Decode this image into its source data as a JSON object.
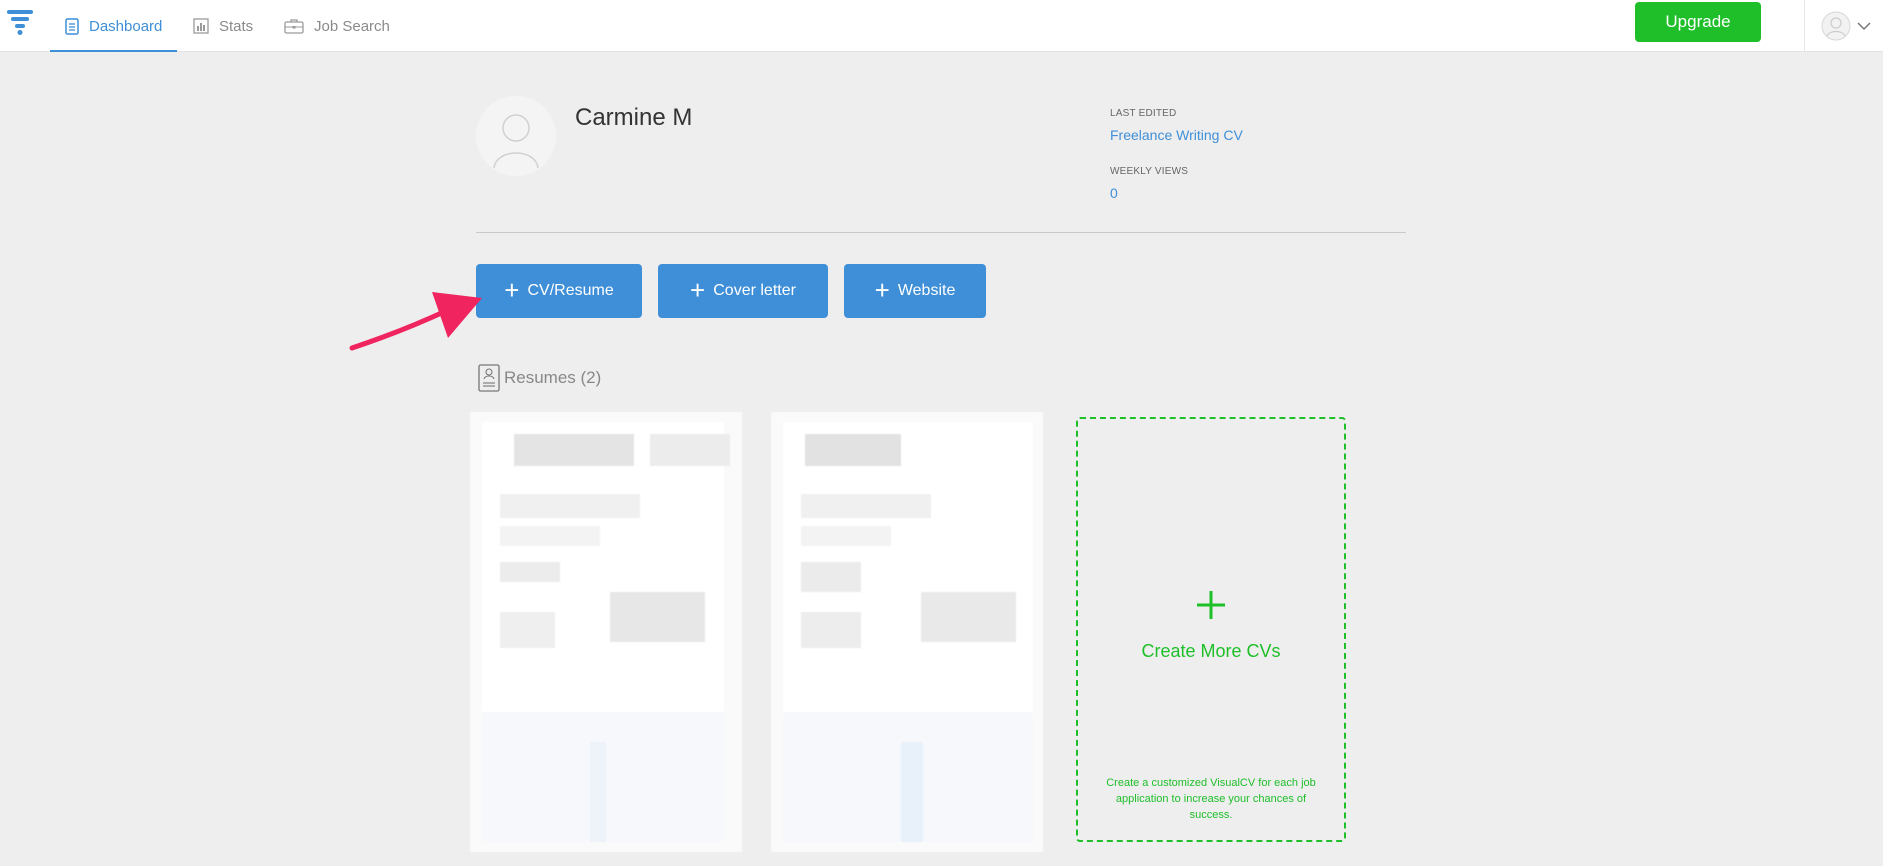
{
  "nav": {
    "tabs": [
      {
        "label": "Dashboard",
        "icon": "document-icon",
        "active": true
      },
      {
        "label": "Stats",
        "icon": "bar-chart-icon",
        "active": false
      },
      {
        "label": "Job Search",
        "icon": "briefcase-icon",
        "active": false
      }
    ],
    "upgrade_label": "Upgrade"
  },
  "profile": {
    "name": "Carmine M",
    "last_edited_label": "LAST EDITED",
    "last_edited_value": "Freelance Writing CV",
    "weekly_views_label": "WEEKLY VIEWS",
    "weekly_views_value": "0"
  },
  "actions": [
    {
      "label": "CV/Resume"
    },
    {
      "label": "Cover letter"
    },
    {
      "label": "Website"
    }
  ],
  "resumes": {
    "heading": "Resumes (2)"
  },
  "create_card": {
    "title": "Create More CVs",
    "description": "Create a customized VisualCV for each job application to increase your chances of success."
  },
  "colors": {
    "accent_blue": "#3f8fd8",
    "accent_green": "#1fbf2a",
    "annotation_arrow": "#f0245f",
    "background": "#eeeeee"
  }
}
